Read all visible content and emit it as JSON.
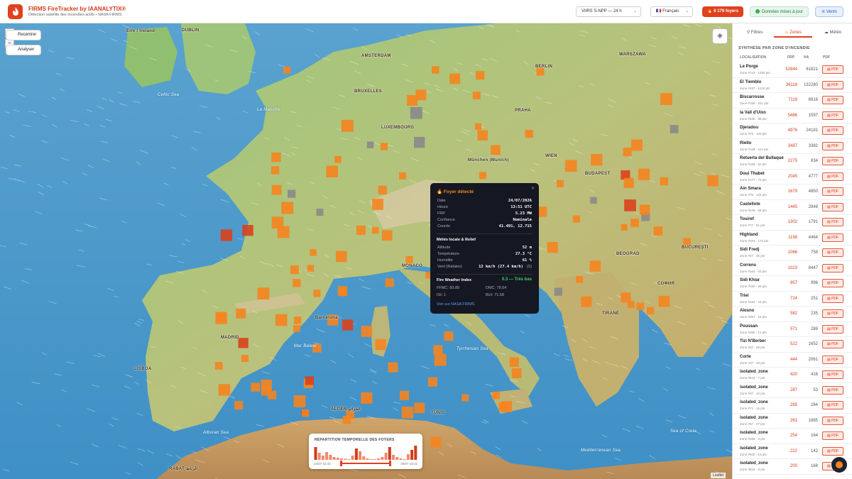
{
  "app": {
    "title": "FIRMS FireTracker by IAANALYTIX®",
    "subtitle": "Détection satellite des incendies actifs • NASA FIRMS"
  },
  "header": {
    "satellite_select": "VIIRS S-NPP — 24 h",
    "language_select": "🇫🇷 Français",
    "foyers_badge": "6 179 foyers",
    "data_status": "Données mises à jour",
    "vents_button": "Vents"
  },
  "map": {
    "recenter_label": "Recentrer",
    "analyze_label": "Analyser",
    "zoom_in": "+",
    "zoom_out": "−",
    "attribution": "Leaflet",
    "labels": {
      "eire": "Éire / Ireland",
      "dublin": "DUBLIN",
      "amsterdam": "AMSTERDAM",
      "berlin": "BERLIN",
      "warszawa": "WARSZAWA",
      "bruxelles": "BRUXELLES",
      "luxembourg": "LUXEMBOURG",
      "praha": "PRAHA",
      "munchen": "München (Munich)",
      "wien": "WIEN",
      "budapest": "BUDAPEST",
      "bucuresti": "BUCUREȘTI",
      "beograd": "BEOGRAD",
      "sofia": "СОФИЯ",
      "madrid": "MADRID",
      "lisboa": "LISBOA",
      "barcelona": "Barcelona",
      "monaco": "MONACO",
      "tirane": "TIRANË",
      "algiers": "ALGER الجزائر",
      "tunis": "TUNIS",
      "rabat": "RABAT الرباط",
      "mer_baleares": "Mar Balear",
      "tyrrhenian": "Tyrrhenian Sea",
      "alboran": "Alboran Sea",
      "mediterranean": "Mediterranean Sea",
      "celtic": "Celtic Sea",
      "la_manche": "La Manche",
      "sea_of_crete": "Sea of Crete"
    }
  },
  "popup": {
    "title": "Foyer détecté",
    "close": "✕",
    "fields": [
      {
        "label": "Date",
        "value": "24/07/2026"
      },
      {
        "label": "Heure",
        "value": "13:51 UTC"
      },
      {
        "label": "FRP",
        "value": "5.23 MW"
      },
      {
        "label": "Confiance",
        "value": "Nominale"
      },
      {
        "label": "Coords",
        "value": "41.491, 12.715"
      }
    ],
    "meteo_title": "Météo locale & Relief",
    "meteo": [
      {
        "label": "Altitude",
        "value": "52 m"
      },
      {
        "label": "Température",
        "value": "27.3 °C"
      },
      {
        "label": "Humidité",
        "value": "61 %"
      },
      {
        "label": "Vent (Rafales)",
        "value": "12 km/h (27.4 km/h)"
      }
    ],
    "wind_dir": "(S)",
    "fwi_title": "Fire Weather Index",
    "fwi_value": "0.3 — Très bas",
    "fwi_details": {
      "ffmc": "FFMC: 83.89",
      "dmc": "DMC: 79.54",
      "isi": "ISI: 1",
      "bui": "BUI: 71.58"
    },
    "link": "Voir sur NASA FIRMS"
  },
  "timeline": {
    "title": "RÉPARTITION TEMPORELLE DES FOYERS",
    "start": "24/07 02:32",
    "end": "25/07 15:21",
    "bars": [
      0.9,
      0.5,
      0.3,
      0.55,
      0.35,
      0.2,
      0.15,
      0.1,
      0.08,
      0.05,
      0.3,
      0.8,
      0.6,
      0.25,
      0.1,
      0.05,
      0.05,
      0.1,
      0.2,
      0.5,
      0.9,
      0.35,
      0.2,
      0.1,
      0.05,
      0.4,
      0.7,
      1.0
    ]
  },
  "sidebar": {
    "tabs": [
      "Filtres",
      "Zones",
      "Météo"
    ],
    "section_title": "SYNTHÈSE PAR ZONE D'INCENDIE",
    "columns": {
      "location": "LOCALISATION",
      "frp": "FRP",
      "ha": "HA",
      "pdf": "PDF"
    },
    "pdf_label": "PDF",
    "zones": [
      {
        "name": "Le Porge",
        "meta": "Zone #143 · 1280 pts",
        "frp": "52844",
        "ha": "61821"
      },
      {
        "name": "El Tiemblo",
        "meta": "Zone #157 · 1142 pts",
        "frp": "36118",
        "ha": "132280"
      },
      {
        "name": "Biscarrosse",
        "meta": "Zone #168 · 421 pts",
        "frp": "7119",
        "ha": "8918"
      },
      {
        "name": "la Vall d'Uixo",
        "meta": "Zone #628 · 88 pts",
        "frp": "5486",
        "ha": "1597"
      },
      {
        "name": "Djeradou",
        "meta": "Zone #75 · 100 pts",
        "frp": "4976",
        "ha": "24181"
      },
      {
        "name": "Riello",
        "meta": "Zone #149 · 114 pts",
        "frp": "3487",
        "ha": "3382"
      },
      {
        "name": "Retuerta del Bullaque",
        "meta": "Zone #159 · 52 pts",
        "frp": "2275",
        "ha": "834"
      },
      {
        "name": "Doui Thabet",
        "meta": "Zone #177 · 73 pts",
        "frp": "2045",
        "ha": "4777"
      },
      {
        "name": "Ain Smara",
        "meta": "Zone #76 · 125 pts",
        "frp": "1679",
        "ha": "4850"
      },
      {
        "name": "Castellote",
        "meta": "Zone #249 · 58 pts",
        "frp": "1445",
        "ha": "2848"
      },
      {
        "name": "Touiref",
        "meta": "Zone #77 · 51 pts",
        "frp": "1302",
        "ha": "1791"
      },
      {
        "name": "Highland",
        "meta": "Zone #103 · 173 pts",
        "frp": "1198",
        "ha": "4464"
      },
      {
        "name": "Sidi Fredj",
        "meta": "Zone #27 · 46 pts",
        "frp": "1066",
        "ha": "758"
      },
      {
        "name": "Correns",
        "meta": "Zone #164 · 53 pts",
        "frp": "1023",
        "ha": "8447"
      },
      {
        "name": "Sidi Khiar",
        "meta": "Zone #100 · 39 pts",
        "frp": "857",
        "ha": "996"
      },
      {
        "name": "Triei",
        "meta": "Zone #232 · 15 pts",
        "frp": "724",
        "ha": "251"
      },
      {
        "name": "Alosno",
        "meta": "Zone #357 · 15 pts",
        "frp": "582",
        "ha": "235"
      },
      {
        "name": "Poussan",
        "meta": "Zone #280 · 12 pts",
        "frp": "571",
        "ha": "288"
      },
      {
        "name": "Tizi N'Berber",
        "meta": "Zone #40 · 55 pts",
        "frp": "522",
        "ha": "1652"
      },
      {
        "name": "Corte",
        "meta": "Zone #37 · 48 pts",
        "frp": "444",
        "ha": "2061"
      },
      {
        "name": "isolated_zone",
        "meta": "Zone #518 · 7 pts",
        "frp": "420",
        "ha": "416"
      },
      {
        "name": "isolated_zone",
        "meta": "Zone #37 · 10 pts",
        "frp": "287",
        "ha": "53"
      },
      {
        "name": "isolated_zone",
        "meta": "Zone #71 · 15 pts",
        "frp": "285",
        "ha": "264"
      },
      {
        "name": "isolated_zone",
        "meta": "Zone #57 · 27 pts",
        "frp": "261",
        "ha": "1885"
      },
      {
        "name": "isolated_zone",
        "meta": "Zone #368 · 8 pts",
        "frp": "254",
        "ha": "164"
      },
      {
        "name": "isolated_zone",
        "meta": "Zone #600 · 13 pts",
        "frp": "222",
        "ha": "142"
      },
      {
        "name": "isolated_zone",
        "meta": "Zone #815 · 8 pts",
        "frp": "200",
        "ha": "168"
      }
    ]
  },
  "colors": {
    "accent": "#e0411f",
    "fire": "#f5841f",
    "fire_hot": "#e2451c",
    "ok_green": "#2cae4f",
    "blue": "#1f6fd6",
    "popup_bg": "#151822"
  }
}
